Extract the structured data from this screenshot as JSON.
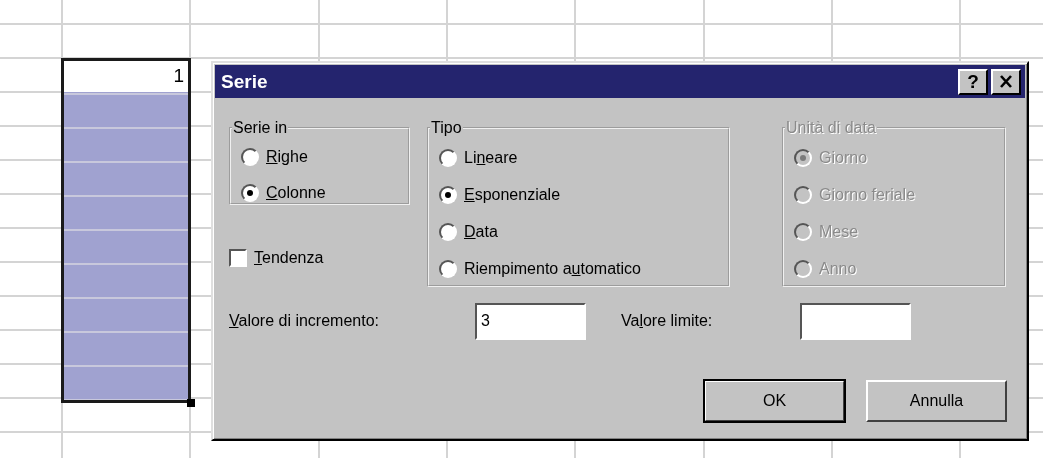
{
  "sheet": {
    "active_cell": "1"
  },
  "dialog": {
    "title": "Serie",
    "help_button": "?",
    "groups": [
      {
        "title": "Serie in",
        "disabled": false,
        "options": [
          {
            "key": "R",
            "post": "ighe",
            "selected": false
          },
          {
            "key": "C",
            "post": "olonne",
            "selected": true
          }
        ]
      },
      {
        "title": "Tipo",
        "disabled": false,
        "options": [
          {
            "pre": "Li",
            "key": "n",
            "post": "eare",
            "selected": false
          },
          {
            "key": "E",
            "post": "sponenziale",
            "selected": true
          },
          {
            "key": "D",
            "post": "ata",
            "selected": false
          },
          {
            "pre": "Riempimento a",
            "key": "u",
            "post": "tomatico",
            "selected": false
          }
        ]
      },
      {
        "title": "Unità di data",
        "disabled": true,
        "options": [
          {
            "post": "Giorno",
            "selected": true
          },
          {
            "post": "Giorno feriale",
            "selected": false
          },
          {
            "post": "Mese",
            "selected": false
          },
          {
            "post": "Anno",
            "selected": false
          }
        ]
      }
    ],
    "trend": {
      "key": "T",
      "post": "endenza",
      "checked": false
    },
    "fields": [
      {
        "key": "V",
        "post": "alore di incremento:",
        "value": "3"
      },
      {
        "pre": "Va",
        "key": "l",
        "post": "ore limite:"
      }
    ],
    "buttons": [
      {
        "label": "OK",
        "default": true
      },
      {
        "label": "Annulla",
        "default": false
      }
    ]
  }
}
